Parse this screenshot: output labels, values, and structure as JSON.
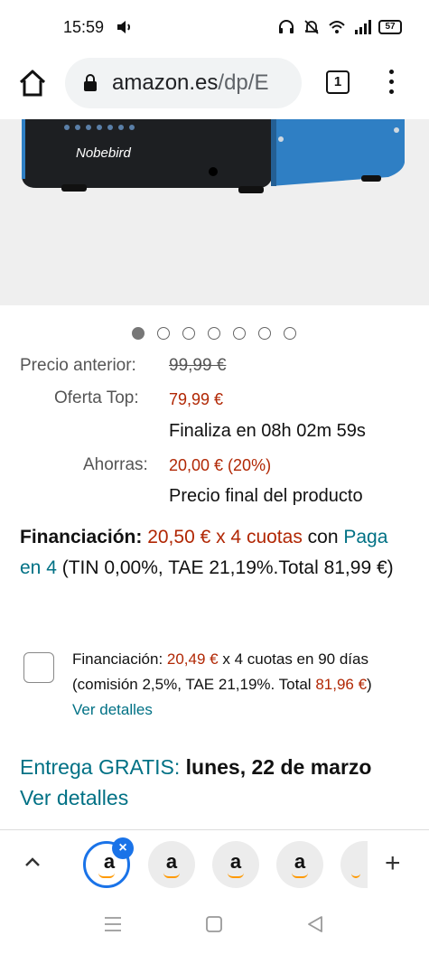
{
  "status_bar": {
    "time": "15:59",
    "battery": "57"
  },
  "browser": {
    "url_main": "amazon.es",
    "url_rest": "/dp/E",
    "tab_count": "1"
  },
  "product_image": {
    "brand": "Nobebird"
  },
  "carousel": {
    "count": 7,
    "active_index": 0
  },
  "pricing": {
    "previous_label": "Precio anterior:",
    "previous_value": "99,99 €",
    "offer_label": "Oferta Top:",
    "offer_value": "79,99 €",
    "ends_text": "Finaliza en 08h 02m 59s",
    "savings_label": "Ahorras:",
    "savings_value": "20,00 € (20%)",
    "final_text": "Precio final del producto"
  },
  "financing": {
    "label": "Financiación:",
    "installments": "20,50 € x 4 cuotas",
    "connector": " con ",
    "link": "Paga en 4",
    "terms": " (TIN 0,00%, TAE 21,19%.Total 81,99 €)"
  },
  "financing_option": {
    "prefix": "Financiación: ",
    "amount": "20,49 €",
    "middle": " x 4 cuotas en 90 días (comisión 2,5%, TAE 21,19%. Total ",
    "total": "81,96 €",
    "suffix": ") ",
    "link": "Ver detalles"
  },
  "delivery": {
    "label": "Entrega GRATIS:",
    "date": " lunes, 22 de marzo",
    "link": "Ver detalles"
  },
  "tabs": {
    "letter": "a",
    "close": "×",
    "add": "+"
  },
  "colors": {
    "price_red": "#b12704",
    "link_teal": "#007185",
    "accent_blue": "#1a73e8",
    "amazon_orange": "#ff9900"
  }
}
